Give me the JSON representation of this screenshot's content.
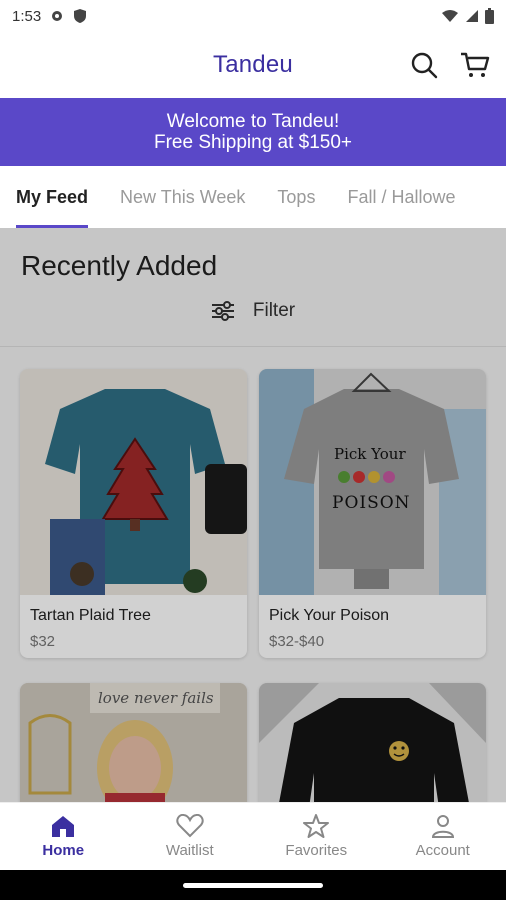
{
  "status_bar": {
    "time": "1:53"
  },
  "app_bar": {
    "title": "Tandeu"
  },
  "banner": {
    "line1": "Welcome to Tandeu!",
    "line2": "Free Shipping at $150+"
  },
  "tabs": [
    {
      "label": "My Feed"
    },
    {
      "label": "New This Week"
    },
    {
      "label": "Tops"
    },
    {
      "label": "Fall / Hallowe"
    }
  ],
  "section": {
    "title": "Recently Added",
    "filter_label": "Filter"
  },
  "products": [
    {
      "name": "Tartan Plaid Tree",
      "price": "$32"
    },
    {
      "name": "Pick Your Poison",
      "price": "$32-$40"
    }
  ],
  "product_images": {
    "poison_line1": "Pick Your",
    "poison_line2": "POISON",
    "sign_text": "love never fails"
  },
  "bottom_nav": [
    {
      "label": "Home"
    },
    {
      "label": "Waitlist"
    },
    {
      "label": "Favorites"
    },
    {
      "label": "Account"
    }
  ],
  "colors": {
    "accent": "#5a48c8",
    "title": "#3b2fa0"
  }
}
